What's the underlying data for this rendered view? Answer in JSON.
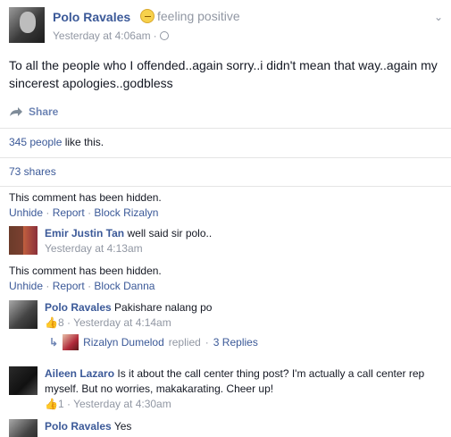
{
  "post": {
    "author": "Polo Ravales",
    "feeling": "feeling positive",
    "timestamp": "Yesterday at 4:06am",
    "separator": "·",
    "text": "To all the people who I offended..again sorry..i didn't mean that way..again my sincerest apologies..godbless",
    "share_label": "Share",
    "likes_count": "345 people",
    "likes_suffix": " like this.",
    "shares": "73 shares"
  },
  "hidden_comments": [
    {
      "text": "This comment has been hidden.",
      "actions": [
        "Unhide",
        "Report",
        "Block Rizalyn"
      ]
    },
    {
      "text": "This comment has been hidden.",
      "actions": [
        "Unhide",
        "Report",
        "Block Danna"
      ]
    }
  ],
  "comments": [
    {
      "author": "Emir Justin Tan",
      "text": "well said sir polo..",
      "meta": "Yesterday at 4:13am"
    },
    {
      "author": "Polo Ravales",
      "text": "Pakishare nalang po",
      "likes": "8",
      "meta": "Yesterday at 4:14am",
      "reply": {
        "name": "Rizalyn Dumelod",
        "action": "replied",
        "count": "3 Replies"
      }
    },
    {
      "author": "Aileen Lazaro",
      "text": "Is it about the call center thing post? I'm actually a call center rep myself. But no worries, makakarating. Cheer up!",
      "likes": "1",
      "meta": "Yesterday at 4:30am"
    },
    {
      "author": "Polo Ravales",
      "text": "Yes"
    }
  ],
  "icons": {
    "chevron": "chevron-down-icon",
    "globe": "globe-icon",
    "share": "share-arrow-icon",
    "like": "thumbs-up-icon",
    "reply": "reply-arrow-icon"
  },
  "colors": {
    "link": "#3b5998",
    "meta": "#9197a3",
    "text": "#141823"
  }
}
